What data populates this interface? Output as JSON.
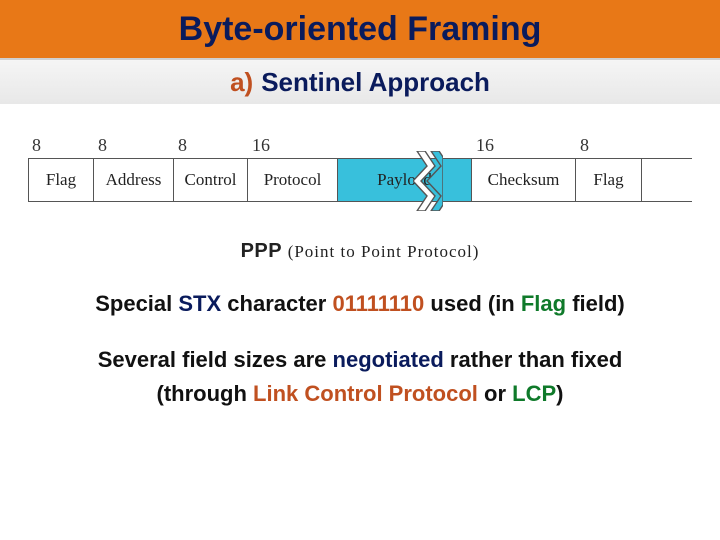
{
  "title": "Byte-oriented Framing",
  "subtitle": {
    "marker": "a)",
    "text": "Sentinel Approach"
  },
  "frame": {
    "bits": [
      "8",
      "8",
      "8",
      "16",
      "",
      "16",
      "8"
    ],
    "fields": [
      "Flag",
      "Address",
      "Control",
      "Protocol",
      "Payload",
      "Checksum",
      "Flag"
    ]
  },
  "caption": {
    "ppp": "PPP",
    "paren": "(Point to Point Protocol)"
  },
  "line1": {
    "pre": "Special ",
    "stx": "STX",
    "mid1": " character ",
    "bits": "01111110",
    "mid2": " used (in ",
    "flag": "Flag",
    "post": " field)"
  },
  "line2": {
    "pre": "Several field sizes are ",
    "neg": "negotiated",
    "mid": " rather than fixed",
    "br_pre": "(through ",
    "lcp": "Link Control Protocol",
    "or": " or ",
    "lcpa": "LCP",
    "post": ")"
  }
}
